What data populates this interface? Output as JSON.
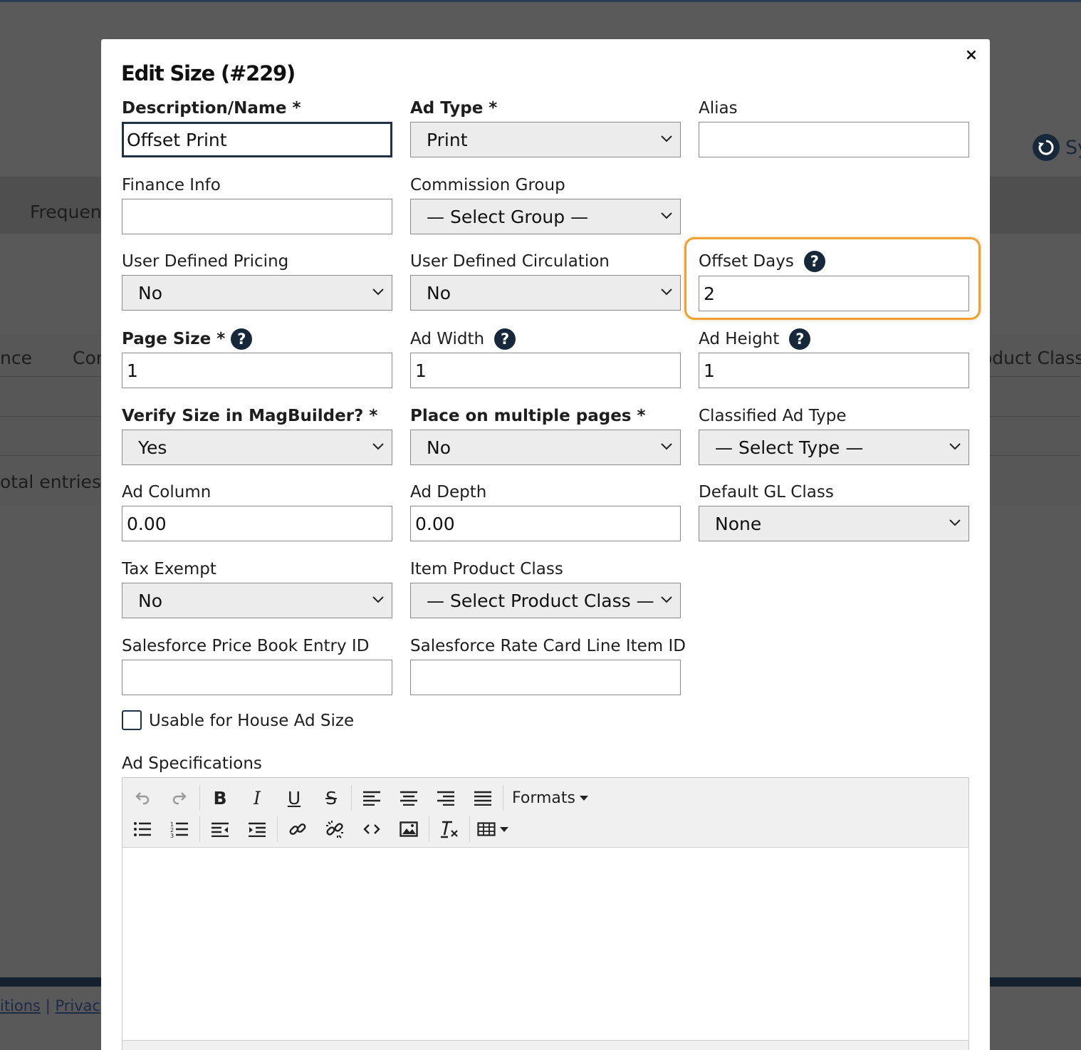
{
  "background": {
    "tab_fragment": "Frequen",
    "col_left": "nce",
    "col_mid": "Con",
    "col_right": "oduct Class",
    "entries_fragment": "otal entries)",
    "sync_label": "Sy",
    "footer_link1": "itions",
    "footer_sep": "|",
    "footer_link2": "Privacy"
  },
  "modal": {
    "title": "Edit Size (#229)",
    "close_symbol": "×",
    "fields": {
      "description": {
        "label": "Description/Name *",
        "value": "Offset Print"
      },
      "ad_type": {
        "label": "Ad Type *",
        "value": "Print"
      },
      "alias": {
        "label": "Alias",
        "value": ""
      },
      "finance_info": {
        "label": "Finance Info",
        "value": ""
      },
      "commission_group": {
        "label": "Commission Group",
        "value": "— Select Group —"
      },
      "user_defined_pricing": {
        "label": "User Defined Pricing",
        "value": "No"
      },
      "user_defined_circulation": {
        "label": "User Defined Circulation",
        "value": "No"
      },
      "offset_days": {
        "label": "Offset Days",
        "value": "2"
      },
      "page_size": {
        "label": "Page Size *",
        "value": "1"
      },
      "ad_width": {
        "label": "Ad Width",
        "value": "1"
      },
      "ad_height": {
        "label": "Ad Height",
        "value": "1"
      },
      "verify_size": {
        "label": "Verify Size in MagBuilder? *",
        "value": "Yes"
      },
      "multiple_pages": {
        "label": "Place on multiple pages *",
        "value": "No"
      },
      "classified_ad_type": {
        "label": "Classified Ad Type",
        "value": "— Select Type —"
      },
      "ad_column": {
        "label": "Ad Column",
        "value": "0.00"
      },
      "ad_depth": {
        "label": "Ad Depth",
        "value": "0.00"
      },
      "default_gl_class": {
        "label": "Default GL Class",
        "value": "None"
      },
      "tax_exempt": {
        "label": "Tax Exempt",
        "value": "No"
      },
      "item_product_class": {
        "label": "Item Product Class",
        "value": "— Select Product Class —"
      },
      "sf_price_book": {
        "label": "Salesforce Price Book Entry ID",
        "value": ""
      },
      "sf_rate_card": {
        "label": "Salesforce Rate Card Line Item ID",
        "value": ""
      },
      "house_ad": {
        "label": "Usable for House Ad Size",
        "checked": false
      },
      "ad_specs": {
        "label": "Ad Specifications"
      }
    },
    "help_symbol": "?",
    "editor": {
      "formats_label": "Formats",
      "icons": [
        "undo-icon",
        "redo-icon",
        "bold-icon",
        "italic-icon",
        "underline-icon",
        "strikethrough-icon",
        "align-left-icon",
        "align-center-icon",
        "align-right-icon",
        "align-justify-icon",
        "bullet-list-icon",
        "numbered-list-icon",
        "outdent-icon",
        "indent-icon",
        "link-icon",
        "unlink-icon",
        "code-icon",
        "image-icon",
        "clear-format-icon",
        "table-icon"
      ]
    },
    "highlight_color": "#f0a032"
  }
}
